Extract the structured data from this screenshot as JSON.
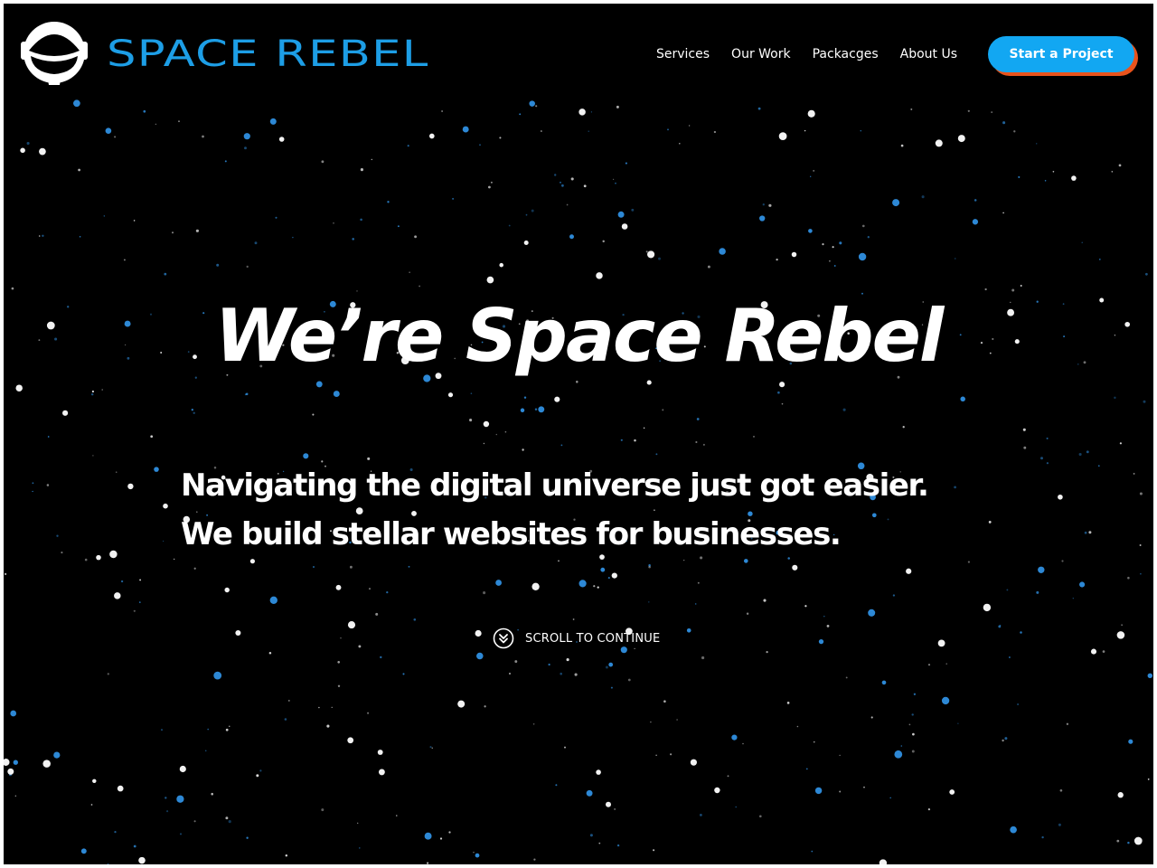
{
  "brand": {
    "name": "SPACE REBEL",
    "icon": "astronaut-helmet-icon",
    "color": "#1d9ee6"
  },
  "nav": {
    "items": [
      {
        "label": "Services"
      },
      {
        "label": "Our Work"
      },
      {
        "label": "Packacges"
      },
      {
        "label": "About Us"
      }
    ],
    "cta_label": "Start a Project",
    "cta_color": "#12a7f2",
    "cta_shadow_color": "#e8531c"
  },
  "hero": {
    "title": "We’re Space Rebel",
    "subtitle_lines": [
      "Navigating the digital universe just got easier.",
      "We build stellar websites for businesses."
    ],
    "scroll_label": "SCROLL TO CONTINUE",
    "scroll_icon": "double-chevron-down-icon"
  },
  "background": {
    "color": "#000000",
    "star_colors": [
      "#ffffff",
      "#2f8fe0"
    ]
  }
}
